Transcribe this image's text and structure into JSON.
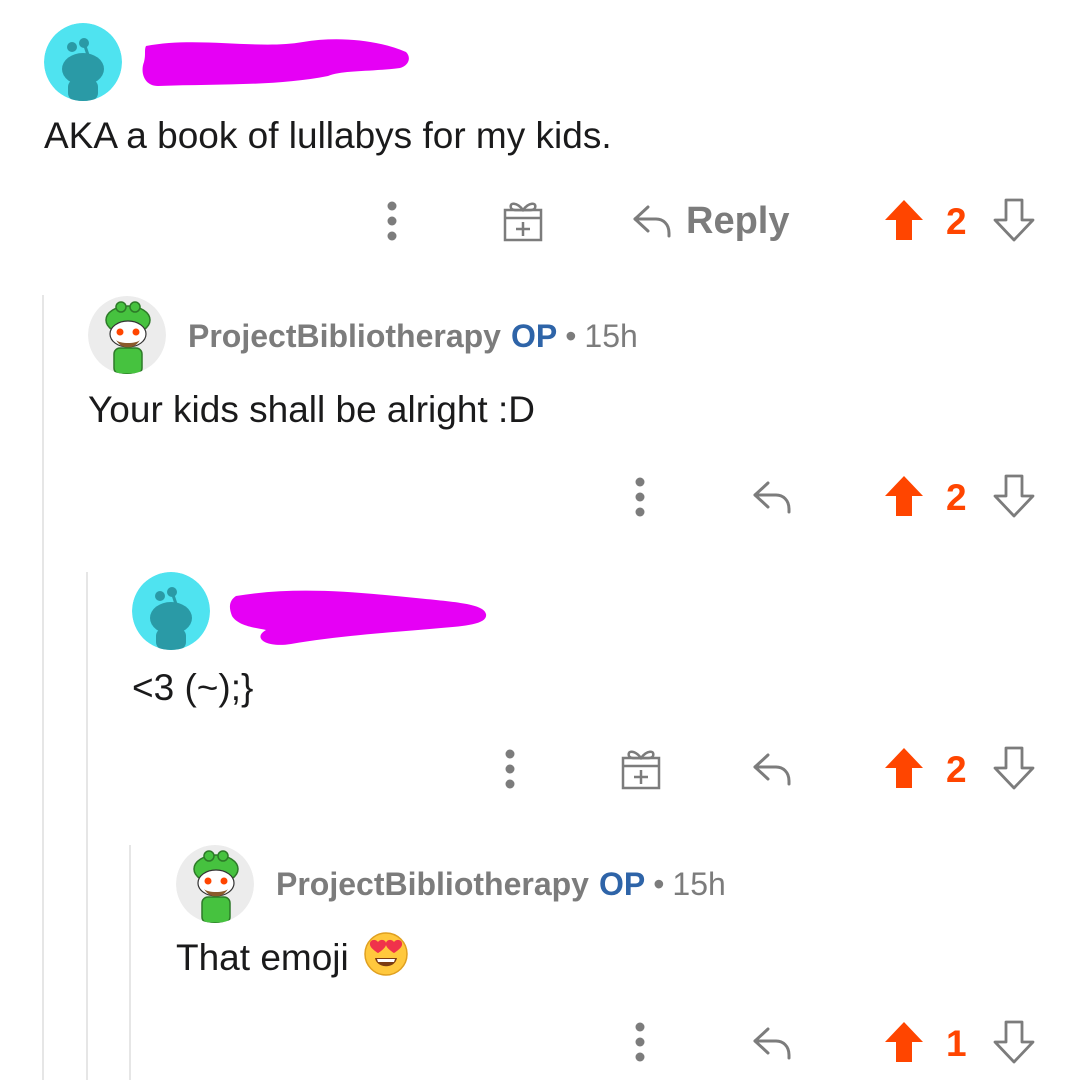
{
  "comments": [
    {
      "author": "",
      "body": "AKA a book of lullabys for my kids.",
      "reply_label": "Reply",
      "score": "2"
    },
    {
      "author": "ProjectBibliotherapy",
      "op_badge": "OP",
      "separator": "•",
      "time": "15h",
      "body": "Your kids shall be alright :D",
      "score": "2"
    },
    {
      "author": "",
      "body": "<3  (~);}",
      "score": "2"
    },
    {
      "author": "ProjectBibliotherapy",
      "op_badge": "OP",
      "separator": "•",
      "time": "15h",
      "body": "That emoji",
      "score": "1"
    }
  ],
  "colors": {
    "upvote_active": "#ff4500",
    "op_badge": "#2e64a8",
    "meta_text": "#7c7c7c",
    "redaction": "#e600f5",
    "thread_line": "#e6e6e6"
  },
  "icons": {
    "more": "vertical-dots-icon",
    "award": "gift-icon",
    "reply": "reply-arrow-icon",
    "upvote": "upvote-arrow-icon",
    "downvote": "downvote-arrow-icon",
    "emoji": "heart-eyes-emoji-icon"
  }
}
